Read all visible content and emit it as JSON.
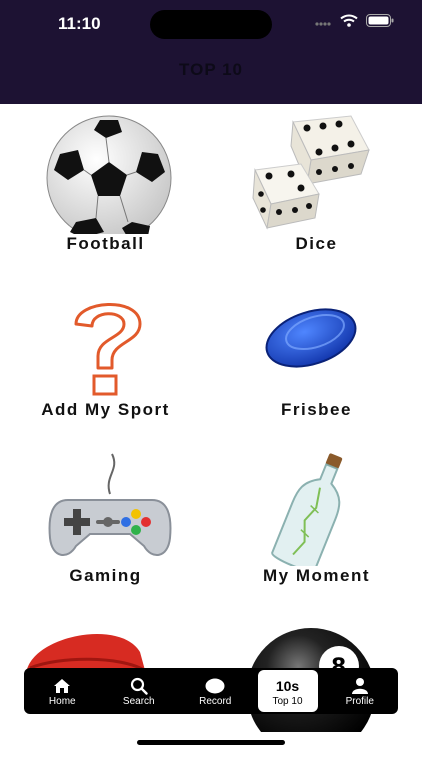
{
  "status": {
    "time": "11:10"
  },
  "header": {
    "title": "TOP 10"
  },
  "items": [
    {
      "label": "Football",
      "icon": "soccer-ball"
    },
    {
      "label": "Dice",
      "icon": "dice"
    },
    {
      "label": "Add My Sport",
      "icon": "question-mark"
    },
    {
      "label": "Frisbee",
      "icon": "frisbee"
    },
    {
      "label": "Gaming",
      "icon": "gamepad"
    },
    {
      "label": "My Moment",
      "icon": "message-bottle"
    },
    {
      "label": "",
      "icon": "red-cap"
    },
    {
      "label": "",
      "icon": "eight-ball"
    }
  ],
  "tabs": [
    {
      "label": "Home",
      "icon": "home-icon"
    },
    {
      "label": "Search",
      "icon": "search-icon"
    },
    {
      "label": "Record",
      "icon": "record-icon"
    },
    {
      "label": "Top 10",
      "icon": "top10-icon",
      "icon_text": "10s",
      "active": true
    },
    {
      "label": "Profile",
      "icon": "profile-icon"
    }
  ],
  "colors": {
    "header_bg": "#1d1233",
    "tabbar_bg": "#000000",
    "question_orange": "#e25a2b",
    "frisbee_blue": "#1f4fd8"
  }
}
